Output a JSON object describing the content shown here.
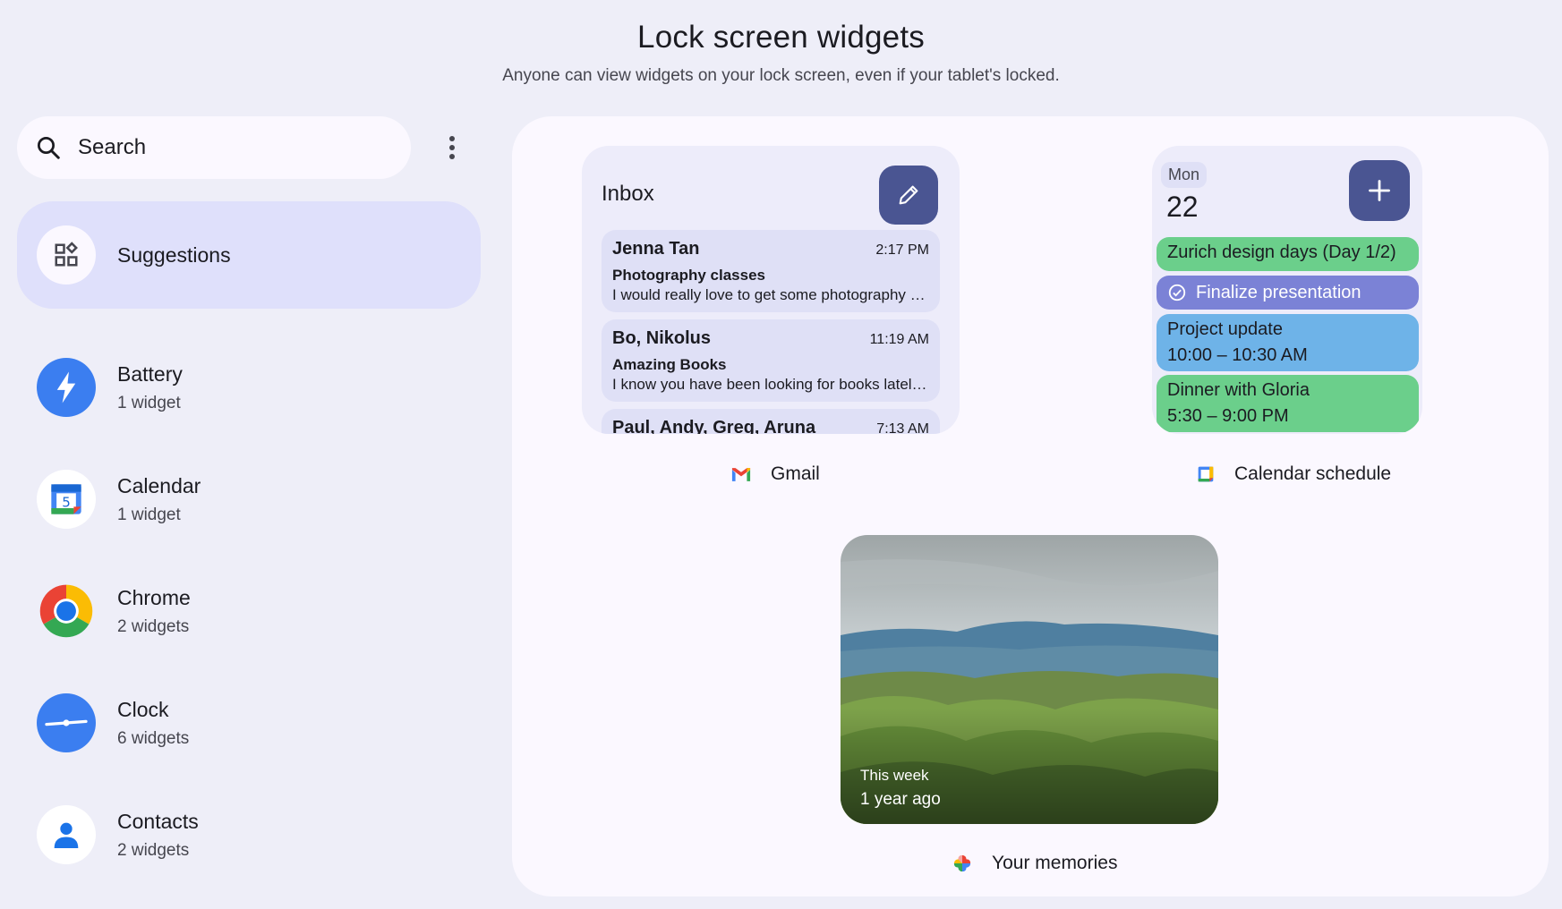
{
  "header": {
    "title": "Lock screen widgets",
    "subtitle": "Anyone can view widgets on your lock screen, even if your tablet's locked."
  },
  "search": {
    "placeholder": "Search"
  },
  "sidebar": {
    "suggestions": "Suggestions",
    "items": [
      {
        "name": "Battery",
        "count": "1 widget"
      },
      {
        "name": "Calendar",
        "count": "1 widget"
      },
      {
        "name": "Chrome",
        "count": "2 widgets"
      },
      {
        "name": "Clock",
        "count": "6 widgets"
      },
      {
        "name": "Contacts",
        "count": "2 widgets"
      }
    ]
  },
  "gmail": {
    "title": "Inbox",
    "label": "Gmail",
    "emails": [
      {
        "from": "Jenna Tan",
        "time": "2:17 PM",
        "subject": "Photography classes",
        "snippet": "I would really love to get some photography c..."
      },
      {
        "from": "Bo, Nikolus",
        "time": "11:19 AM",
        "subject": "Amazing Books",
        "snippet": "I know you have been looking for books lately..."
      },
      {
        "from": "Paul, Andy, Greg, Aruna",
        "time": "7:13 AM"
      }
    ]
  },
  "calendar": {
    "day": "Mon",
    "date": "22",
    "label": "Calendar schedule",
    "events": [
      {
        "title": "Zurich design days (Day 1/2)"
      },
      {
        "title": "Finalize presentation"
      },
      {
        "title": "Project update",
        "time": "10:00 – 10:30 AM"
      },
      {
        "title": "Dinner with Gloria",
        "time": "5:30 – 9:00 PM"
      }
    ]
  },
  "memories": {
    "caption1": "This week",
    "caption2": "1 year ago",
    "label": "Your memories"
  },
  "colors": {
    "background": "#eeeef8",
    "accent": "#4a5592",
    "selected": "#dfe0fb",
    "event_green": "#6bcf8b",
    "event_purple": "#7b82d6",
    "event_blue": "#6eb3e8"
  }
}
